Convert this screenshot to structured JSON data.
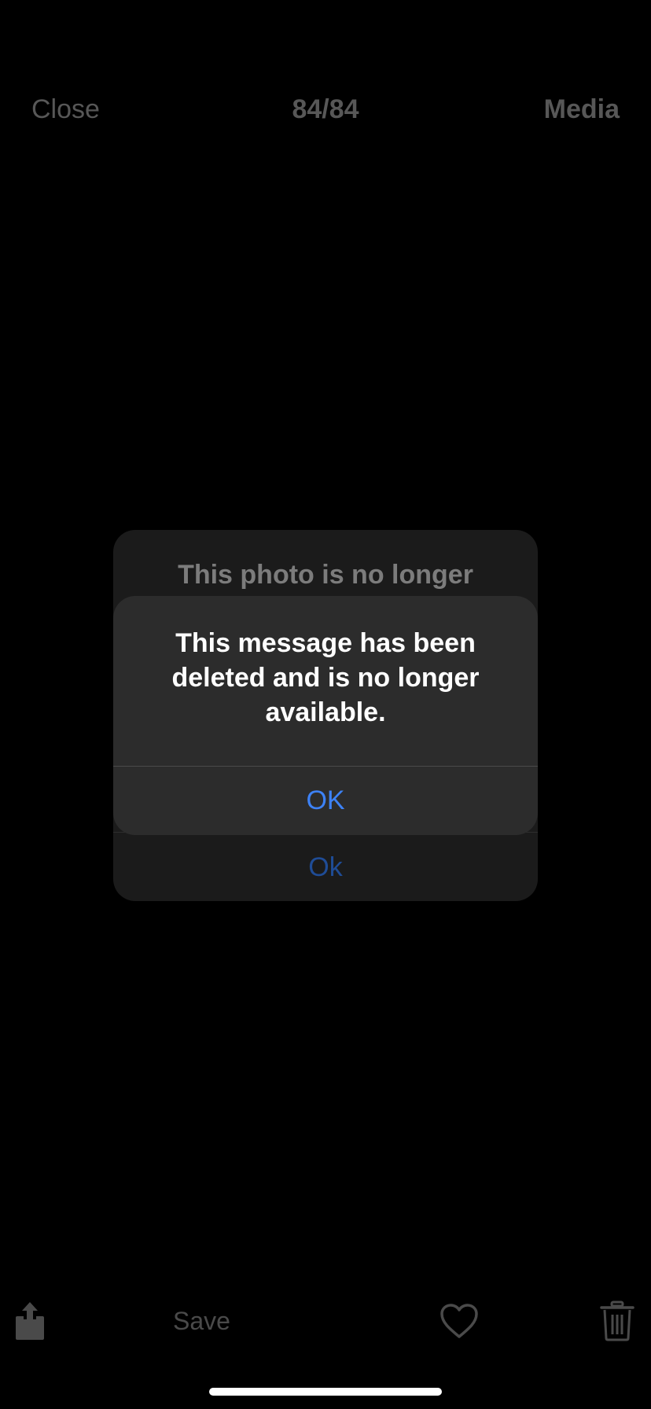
{
  "topbar": {
    "close_label": "Close",
    "counter": "84/84",
    "media_label": "Media"
  },
  "back_alert": {
    "title": "This photo is no longer",
    "ok_label": "Ok"
  },
  "alert": {
    "message": "This message has been deleted and is no longer available.",
    "ok_label": "OK"
  },
  "toolbar": {
    "share_icon": "share-icon",
    "save_label": "Save",
    "heart_icon": "heart-icon",
    "trash_icon": "trash-icon"
  },
  "colors": {
    "background": "#000000",
    "alert_bg": "#2c2c2c",
    "accent": "#3d82f6",
    "dim_text": "#575757"
  }
}
